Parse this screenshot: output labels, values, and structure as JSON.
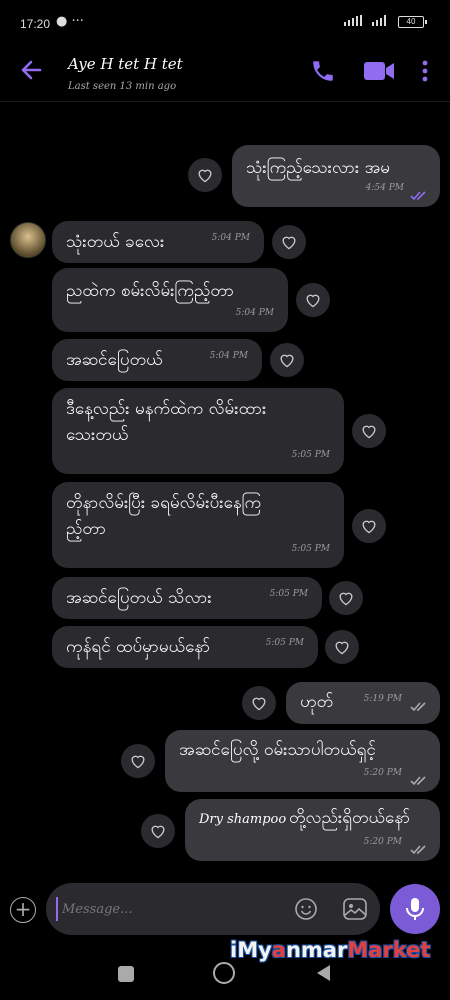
{
  "status": {
    "time": "17:20",
    "battery": "40"
  },
  "header": {
    "name": "Aye H tet H tet",
    "last_seen": "Last seen 13 min ago"
  },
  "messages": [
    {
      "dir": "out",
      "text": "သုံးကြည့်သေးလား အမ",
      "time": "4:54 PM"
    },
    {
      "dir": "in",
      "text": "သုံးတယ် ခလေး",
      "time": "5:04 PM"
    },
    {
      "dir": "in",
      "text": "ညထဲက စမ်းလိမ်းကြည့်တာ",
      "time": "5:04 PM"
    },
    {
      "dir": "in",
      "text": "အဆင်ပြေတယ်",
      "time": "5:04 PM"
    },
    {
      "dir": "in",
      "line1": "ဒီနေ့လည်း မနက်ထဲက လိမ်းထား",
      "line2": "သေးတယ်",
      "time": "5:05 PM"
    },
    {
      "dir": "in",
      "line1": "တိုနာလိမ်းပြီး ခရမ်လိမ်းပီးနေကြ",
      "line2": "ည့်တာ",
      "time": "5:05 PM"
    },
    {
      "dir": "in",
      "text": "အဆင်ပြေတယ် သိလား",
      "time": "5:05 PM"
    },
    {
      "dir": "in",
      "text": "ကုန်ရင် ထပ်မှာမယ်နော်",
      "time": "5:05 PM"
    },
    {
      "dir": "out",
      "text": "ဟုတ်",
      "time": "5:19 PM"
    },
    {
      "dir": "out",
      "text": "အဆင်ပြေလို့ ဝမ်းသာပါတယ်ရှင့်",
      "time": "5:20 PM"
    },
    {
      "dir": "out",
      "text_en": "Dry shampoo",
      "text_mm": " တို့လည်းရှိတယ်နော်",
      "time": "5:20 PM"
    }
  ],
  "composer": {
    "placeholder": "Message..."
  },
  "watermark": {
    "part1": "iMy",
    "part2": "a",
    "part3": "nmar",
    "part4": "Market"
  },
  "colors": {
    "accent": "#7b5cd6",
    "bubble": "#2b2b2f",
    "background": "#000000"
  }
}
